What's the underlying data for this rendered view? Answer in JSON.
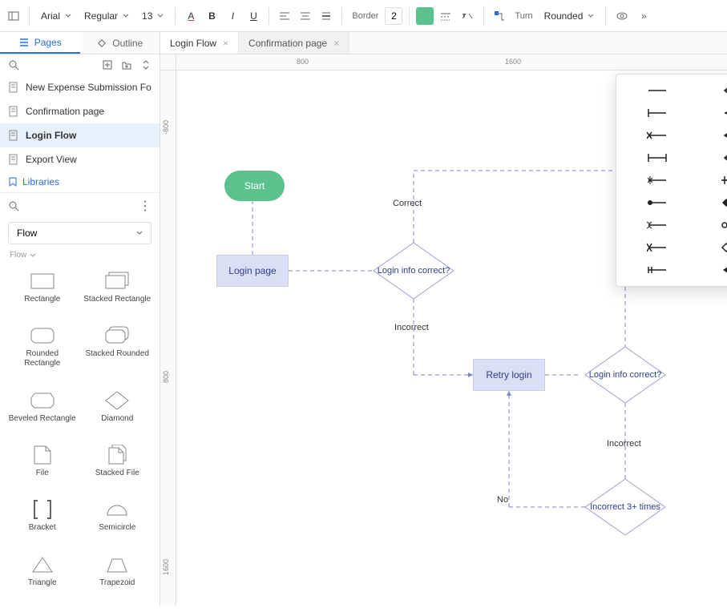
{
  "toolbar": {
    "font_family": "Arial",
    "font_weight": "Regular",
    "font_size": "13",
    "border_label": "Border",
    "border_width": "2",
    "turn_label": "Turn",
    "corner_style": "Rounded",
    "fill_color": "#5bc28e"
  },
  "sidebar_tabs": {
    "pages": "Pages",
    "outline": "Outline"
  },
  "doc_tabs": [
    {
      "label": "Login Flow",
      "active": true
    },
    {
      "label": "Confirmation page",
      "active": false
    }
  ],
  "pages": [
    {
      "label": "New Expense Submission Fo",
      "icon": "doc",
      "active": false
    },
    {
      "label": "Confirmation page",
      "icon": "doc",
      "active": false
    },
    {
      "label": "Login Flow",
      "icon": "doc",
      "active": true
    },
    {
      "label": "Export View",
      "icon": "doc",
      "active": false
    }
  ],
  "libraries_label": "Libraries",
  "shape_category": "Flow",
  "shape_category_sub": "Flow",
  "shapes": [
    {
      "name": "rectangle",
      "label": "Rectangle"
    },
    {
      "name": "stacked-rectangle",
      "label": "Stacked Rectangle"
    },
    {
      "name": "rounded-rectangle",
      "label": "Rounded Rectangle"
    },
    {
      "name": "stacked-rounded",
      "label": "Stacked Rounded"
    },
    {
      "name": "beveled-rectangle",
      "label": "Beveled Rectangle"
    },
    {
      "name": "diamond",
      "label": "Diamond"
    },
    {
      "name": "file",
      "label": "File"
    },
    {
      "name": "stacked-file",
      "label": "Stacked File"
    },
    {
      "name": "bracket",
      "label": "Bracket"
    },
    {
      "name": "semicircle",
      "label": "Semicircle"
    },
    {
      "name": "triangle",
      "label": "Triangle"
    },
    {
      "name": "trapezoid",
      "label": "Trapezoid"
    }
  ],
  "ruler_h": [
    "800",
    "1600"
  ],
  "ruler_v": [
    "-800",
    "800",
    "1600"
  ],
  "flowchart": {
    "start": "Start",
    "login_page": "Login page",
    "correct": "Correct",
    "login_info_correct": "Login info correct?",
    "incorrect": "Incorrect",
    "retry_login": "Retry login",
    "login_info_correct2": "Login info correct?",
    "incorrect2": "Incorrect",
    "incorrect_3x": "Incorrect 3+ times",
    "no": "No"
  },
  "arrow_picker": {
    "rows": 9,
    "cols": 3,
    "selected_index": 8,
    "styles": [
      "none-none",
      "arrow-open-left",
      "arrow-open-both",
      "t-bar-left",
      "arrow-solid-left",
      "arrow-solid-both",
      "x-bar-left",
      "arrow-hollow-left",
      "arrow-hollow-both",
      "i-bar-left",
      "double-arrow-left",
      "double-arrow-both",
      "asterisk-left",
      "plus-left",
      "plus-both",
      "dot-solid-left",
      "diamond-solid-left",
      "diamond-solid-both",
      "scissor-left",
      "dot-hollow-left",
      "dot-hollow-both",
      "angle-left",
      "diamond-hollow-left",
      "diamond-hollow-both",
      "h-bar-left",
      "rewind-left",
      "rewind-both"
    ]
  }
}
